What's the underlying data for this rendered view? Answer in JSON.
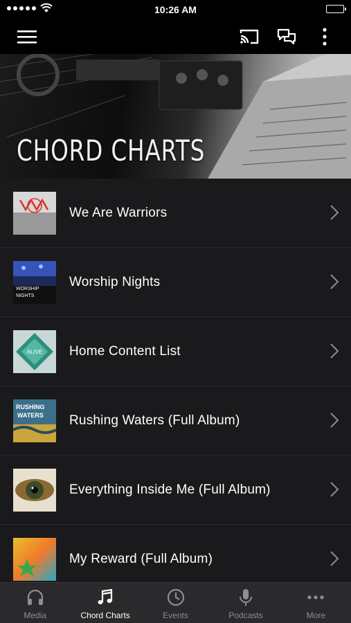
{
  "status_bar": {
    "time": "10:26 AM"
  },
  "banner": {
    "title": "CHORD CHARTS"
  },
  "list": [
    {
      "title": "We Are Warriors",
      "art": "warriors"
    },
    {
      "title": "Worship Nights",
      "art": "worship",
      "art_text": [
        "WORSHIP",
        "NIGHTS"
      ]
    },
    {
      "title": "Home Content List",
      "art": "alive",
      "art_text": [
        "ALIVE"
      ]
    },
    {
      "title": "Rushing Waters (Full Album)",
      "art": "waters",
      "art_text": [
        "RUSHING",
        "WATERS"
      ]
    },
    {
      "title": "Everything Inside Me (Full Album)",
      "art": "eye"
    },
    {
      "title": "My Reward (Full Album)",
      "art": "reward"
    }
  ],
  "tabs": [
    {
      "label": "Media",
      "icon": "headphones-icon",
      "active": false
    },
    {
      "label": "Chord Charts",
      "icon": "music-note-icon",
      "active": true
    },
    {
      "label": "Events",
      "icon": "clock-icon",
      "active": false
    },
    {
      "label": "Podcasts",
      "icon": "microphone-icon",
      "active": false
    },
    {
      "label": "More",
      "icon": "more-dots-icon",
      "active": false
    }
  ],
  "colors": {
    "background": "#1a1a1c",
    "tab_bar": "#2a2a2c",
    "inactive": "#8e8e93",
    "active": "#ffffff"
  }
}
